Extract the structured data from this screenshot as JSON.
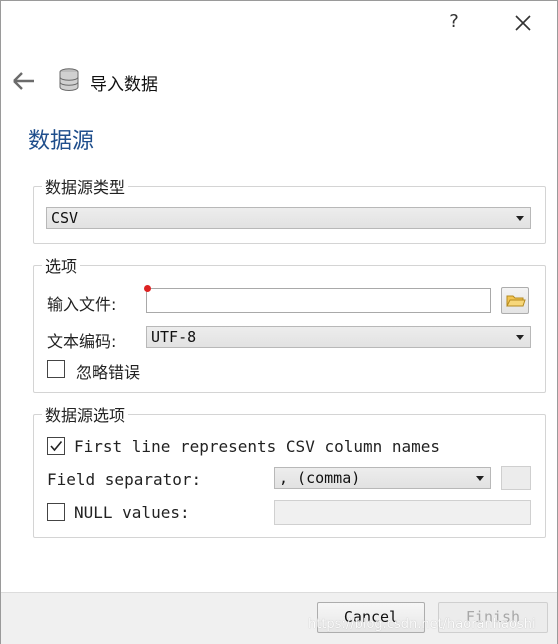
{
  "titlebar": {
    "help_label": "?"
  },
  "header": {
    "title": "导入数据"
  },
  "page": {
    "title": "数据源"
  },
  "datasource_type": {
    "legend": "数据源类型",
    "selected": "CSV"
  },
  "options": {
    "legend": "选项",
    "input_file_label": "输入文件:",
    "input_file_value": "",
    "encoding_label": "文本编码:",
    "encoding_value": "UTF-8",
    "ignore_errors_label": "忽略错误",
    "ignore_errors_checked": false
  },
  "datasource_options": {
    "legend": "数据源选项",
    "first_line_label": "First line represents CSV column names",
    "first_line_checked": true,
    "field_separator_label": "Field separator:",
    "field_separator_value": ", (comma)",
    "null_values_label": "NULL values:",
    "null_values_checked": false,
    "null_values_value": ""
  },
  "footer": {
    "cancel_label": "Cancel",
    "finish_label": "Finish",
    "watermark": "https://blog.csdn.net/haoranhaoshi"
  },
  "colors": {
    "page_title": "#1f4e8c",
    "required": "#dd2222"
  }
}
